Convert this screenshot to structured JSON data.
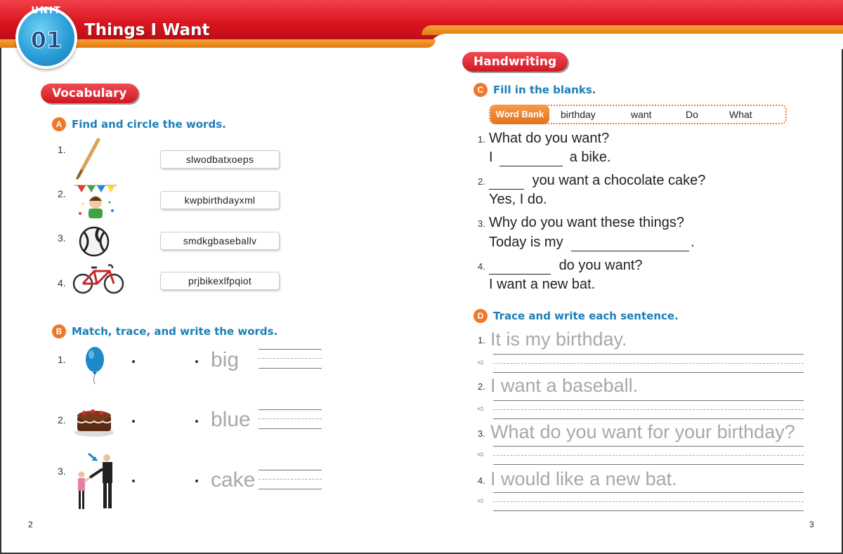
{
  "header": {
    "unit_label": "UNIT",
    "unit_number": "01",
    "title": "Things I Want"
  },
  "vocabulary": {
    "pill": "Vocabulary",
    "activity_a": {
      "letter": "A",
      "instruction": "Find and circle the words.",
      "items": [
        {
          "num": "1.",
          "picture": "baseball-bat-icon",
          "puzzle": "slwodbatxoeps"
        },
        {
          "num": "2.",
          "picture": "birthday-boy-icon",
          "puzzle": "kwpbirthdayxml"
        },
        {
          "num": "3.",
          "picture": "baseball-icon",
          "puzzle": "smdkgbaseballv"
        },
        {
          "num": "4.",
          "picture": "bicycle-icon",
          "puzzle": "prjbikexlfpqiot"
        }
      ]
    },
    "activity_b": {
      "letter": "B",
      "instruction": "Match, trace, and write the words.",
      "items": [
        {
          "num": "1.",
          "picture": "balloon-icon",
          "word": "big"
        },
        {
          "num": "2.",
          "picture": "cake-icon",
          "word": "blue"
        },
        {
          "num": "3.",
          "picture": "people-icon",
          "word": "cake"
        }
      ]
    }
  },
  "handwriting": {
    "pill": "Handwriting",
    "activity_c": {
      "letter": "C",
      "instruction": "Fill in the blanks.",
      "word_bank_label": "Word Bank",
      "word_bank": [
        "birthday",
        "want",
        "Do",
        "What"
      ],
      "questions": [
        {
          "num": "1.",
          "line1": "What do you want?",
          "line2_pre": "I",
          "line2_post": "a bike."
        },
        {
          "num": "2.",
          "line1_post": "you want a chocolate cake?",
          "line2": "Yes, I do."
        },
        {
          "num": "3.",
          "line1": "Why do you want these things?",
          "line2_pre": "Today is my",
          "line2_post": "."
        },
        {
          "num": "4.",
          "line1_post": "do you want?",
          "line2": "I want a new bat."
        }
      ]
    },
    "activity_d": {
      "letter": "D",
      "instruction": "Trace and write each sentence.",
      "sentences": [
        {
          "num": "1.",
          "text": "It is my birthday."
        },
        {
          "num": "2.",
          "text": "I want a baseball."
        },
        {
          "num": "3.",
          "text": "What do you want for your birthday?"
        },
        {
          "num": "4.",
          "text": "I would like a new bat."
        }
      ]
    }
  },
  "footer": {
    "left_page": "2",
    "right_page": "3"
  },
  "colors": {
    "banner_red": "#d8141e",
    "banner_orange": "#f08a22",
    "unit_blue": "#2a9ed8",
    "heading_blue": "#1c7fb8",
    "activity_orange": "#f0782a",
    "trace_gray": "#a8a8a8"
  }
}
